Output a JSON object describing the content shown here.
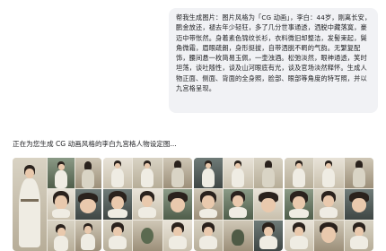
{
  "user_message": {
    "text": "帮我生成图片：图片风格为「CG 动画」，李白：44岁，刚离长安，鹏金放还，褪去年少轻狂，多了几分世事通透，洒脱中藏落寞，豪迈中带怅然。身着素色锦纹长衫，衣料微旧却整洁，发髻束起，鬓角微霜，眉眼疏朗，身形挺拔，自带洒脱不羁的气韵。无繁复配饰，腰间悬一枚简易玉佩，一壶浊酒。松弛淡然，眼神通透，笑时坦荡，谈吐随性，谈及山河眼底有光，谈及官场淡然释怀。生成人物正面、侧面、背面的全身照，脸部、眼部等角度的特写照，并以九宫格呈现。"
  },
  "assistant_message": {
    "status_text": "正在为您生成 CG 动画风格的李白九宫格人物设定图..."
  },
  "gallery": {
    "panels": [
      {
        "name": "panel-1"
      },
      {
        "name": "panel-2"
      },
      {
        "name": "panel-3"
      },
      {
        "name": "panel-4"
      }
    ]
  },
  "colors": {
    "bubble_background": "#f1f2f5",
    "text_primary": "#202124",
    "robe": "#efece3",
    "hair": "#2a221d",
    "skin": "#e9c9ad"
  }
}
